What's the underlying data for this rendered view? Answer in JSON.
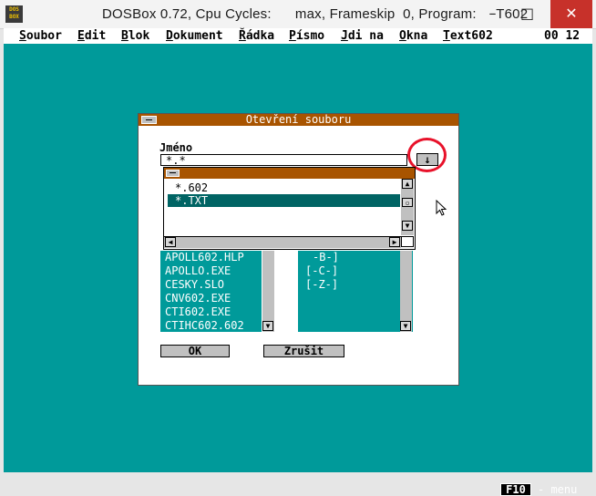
{
  "window": {
    "icon_text": "DOS BOX",
    "title": "DOSBox 0.72, Cpu Cycles:      max, Frameskip  0, Program:     T602",
    "minimize": "–",
    "maximize": "□",
    "close": "✕"
  },
  "menubar": {
    "items": [
      {
        "label": "Soubor",
        "hot": "S"
      },
      {
        "label": "Edit",
        "hot": "E"
      },
      {
        "label": "Blok",
        "hot": "B"
      },
      {
        "label": "Dokument",
        "hot": "D"
      },
      {
        "label": "Řádka",
        "hot": "Ř"
      },
      {
        "label": "Písmo",
        "hot": "P"
      },
      {
        "label": "Jdi na",
        "hot": "J"
      },
      {
        "label": "Okna",
        "hot": "O"
      },
      {
        "label": "Text602",
        "hot": "T"
      }
    ],
    "page_indicator": "00 12"
  },
  "dialog": {
    "title": "Otevření souboru",
    "name_label": "Jméno",
    "name_value": "*.*",
    "dropdown_glyph": "↓",
    "dropdown_items": [
      "*.602",
      "*.TXT"
    ],
    "selected_index": 1,
    "files": [
      "APOLL602.HLP",
      "APOLLO.EXE",
      "CESKY.SLO",
      "CNV602.EXE",
      "CTI602.EXE",
      "CTIHC602.602"
    ],
    "drives": [
      "-B-]",
      "[-C-]",
      "[-Z-]"
    ],
    "ok_label": "OK",
    "cancel_label": "Zrušit"
  },
  "status": {
    "key": "F10",
    "hint": "- menu"
  },
  "colors": {
    "desktop": "#009a9a",
    "title_bar": "#a85400",
    "selection": "#006464",
    "annotation_circle": "#e8122a"
  }
}
